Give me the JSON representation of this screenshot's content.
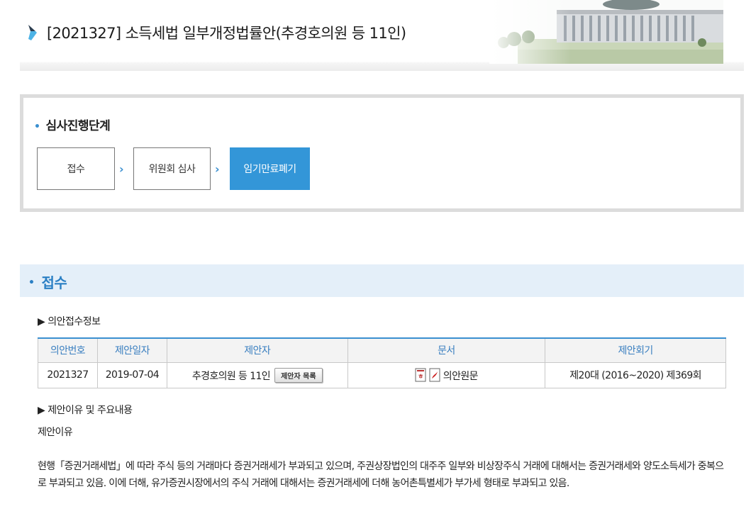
{
  "header": {
    "title": "[2021327] 소득세법 일부개정법률안(추경호의원 등 11인)"
  },
  "stage": {
    "title": "심사진행단계",
    "steps": [
      {
        "label": "접수",
        "active": false
      },
      {
        "label": "위원회 심사",
        "active": false
      },
      {
        "label": "임기만료폐기",
        "active": true
      }
    ]
  },
  "section": {
    "title": "접수",
    "receipt_heading": "▶ 의안접수정보",
    "table": {
      "headers": [
        "의안번호",
        "제안일자",
        "제안자",
        "문서",
        "제안회기"
      ],
      "row": {
        "bill_no": "2021327",
        "date": "2019-07-04",
        "proposer": "추경호의원 등 11인",
        "proposer_button": "제안자 목록",
        "document": "의안원문",
        "session": "제20대 (2016~2020) 제369회"
      }
    },
    "reason_heading": "▶ 제안이유 및 주요내용",
    "reason_label": "제안이유",
    "reason_text": "현행「증권거래세법」에 따라 주식 등의 거래마다 증권거래세가 부과되고 있으며, 주권상장법인의 대주주 일부와 비상장주식 거래에 대해서는 증권거래세와 양도소득세가 중복으로 부과되고 있음. 이에 더해, 유가증권시장에서의 주식 거래에 대해서는 증권거래세에 더해 농어촌특별세가 부가세 형태로 부과되고 있음."
  },
  "colors": {
    "accent": "#3396d8",
    "section_bg": "#e4eff9",
    "section_text": "#2a7fc4"
  }
}
